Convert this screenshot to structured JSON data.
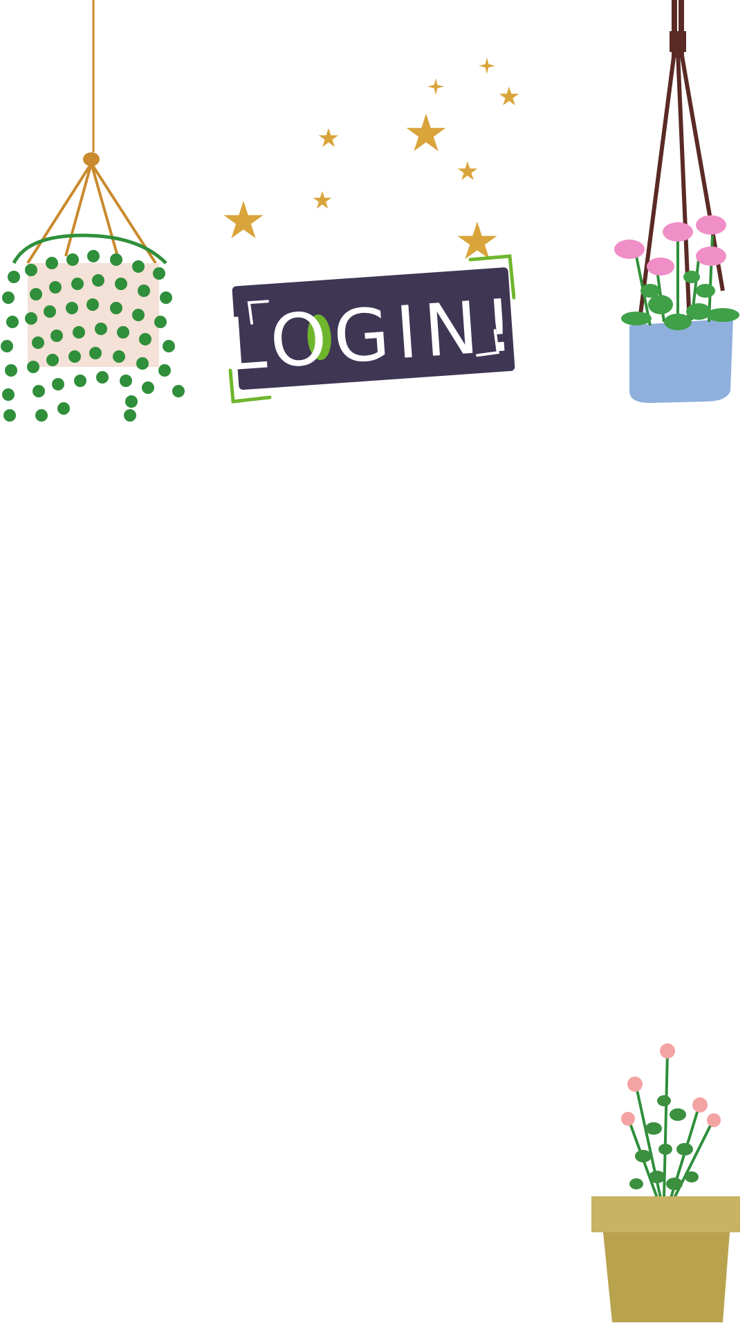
{
  "login": {
    "title": "LOGIN!"
  },
  "colors": {
    "banner_bg": "#3f3654",
    "accent_green": "#6fb62c",
    "star_gold": "#d9a43b",
    "vine_green": "#2f8f3a",
    "pot_peach": "#f4e1d7",
    "pot_blue": "#8fb0dd",
    "rope_brown": "#5a2a24",
    "rope_orange": "#c98a2d",
    "flower_pink": "#f08fc7",
    "terracotta_pot": "#b9a24e"
  },
  "icons": {
    "left_plant": "hanging-vine-plant-icon",
    "right_plant": "hanging-flower-plant-icon",
    "bottom_plant": "potted-flower-icon",
    "stars": "star-cluster-icon"
  }
}
